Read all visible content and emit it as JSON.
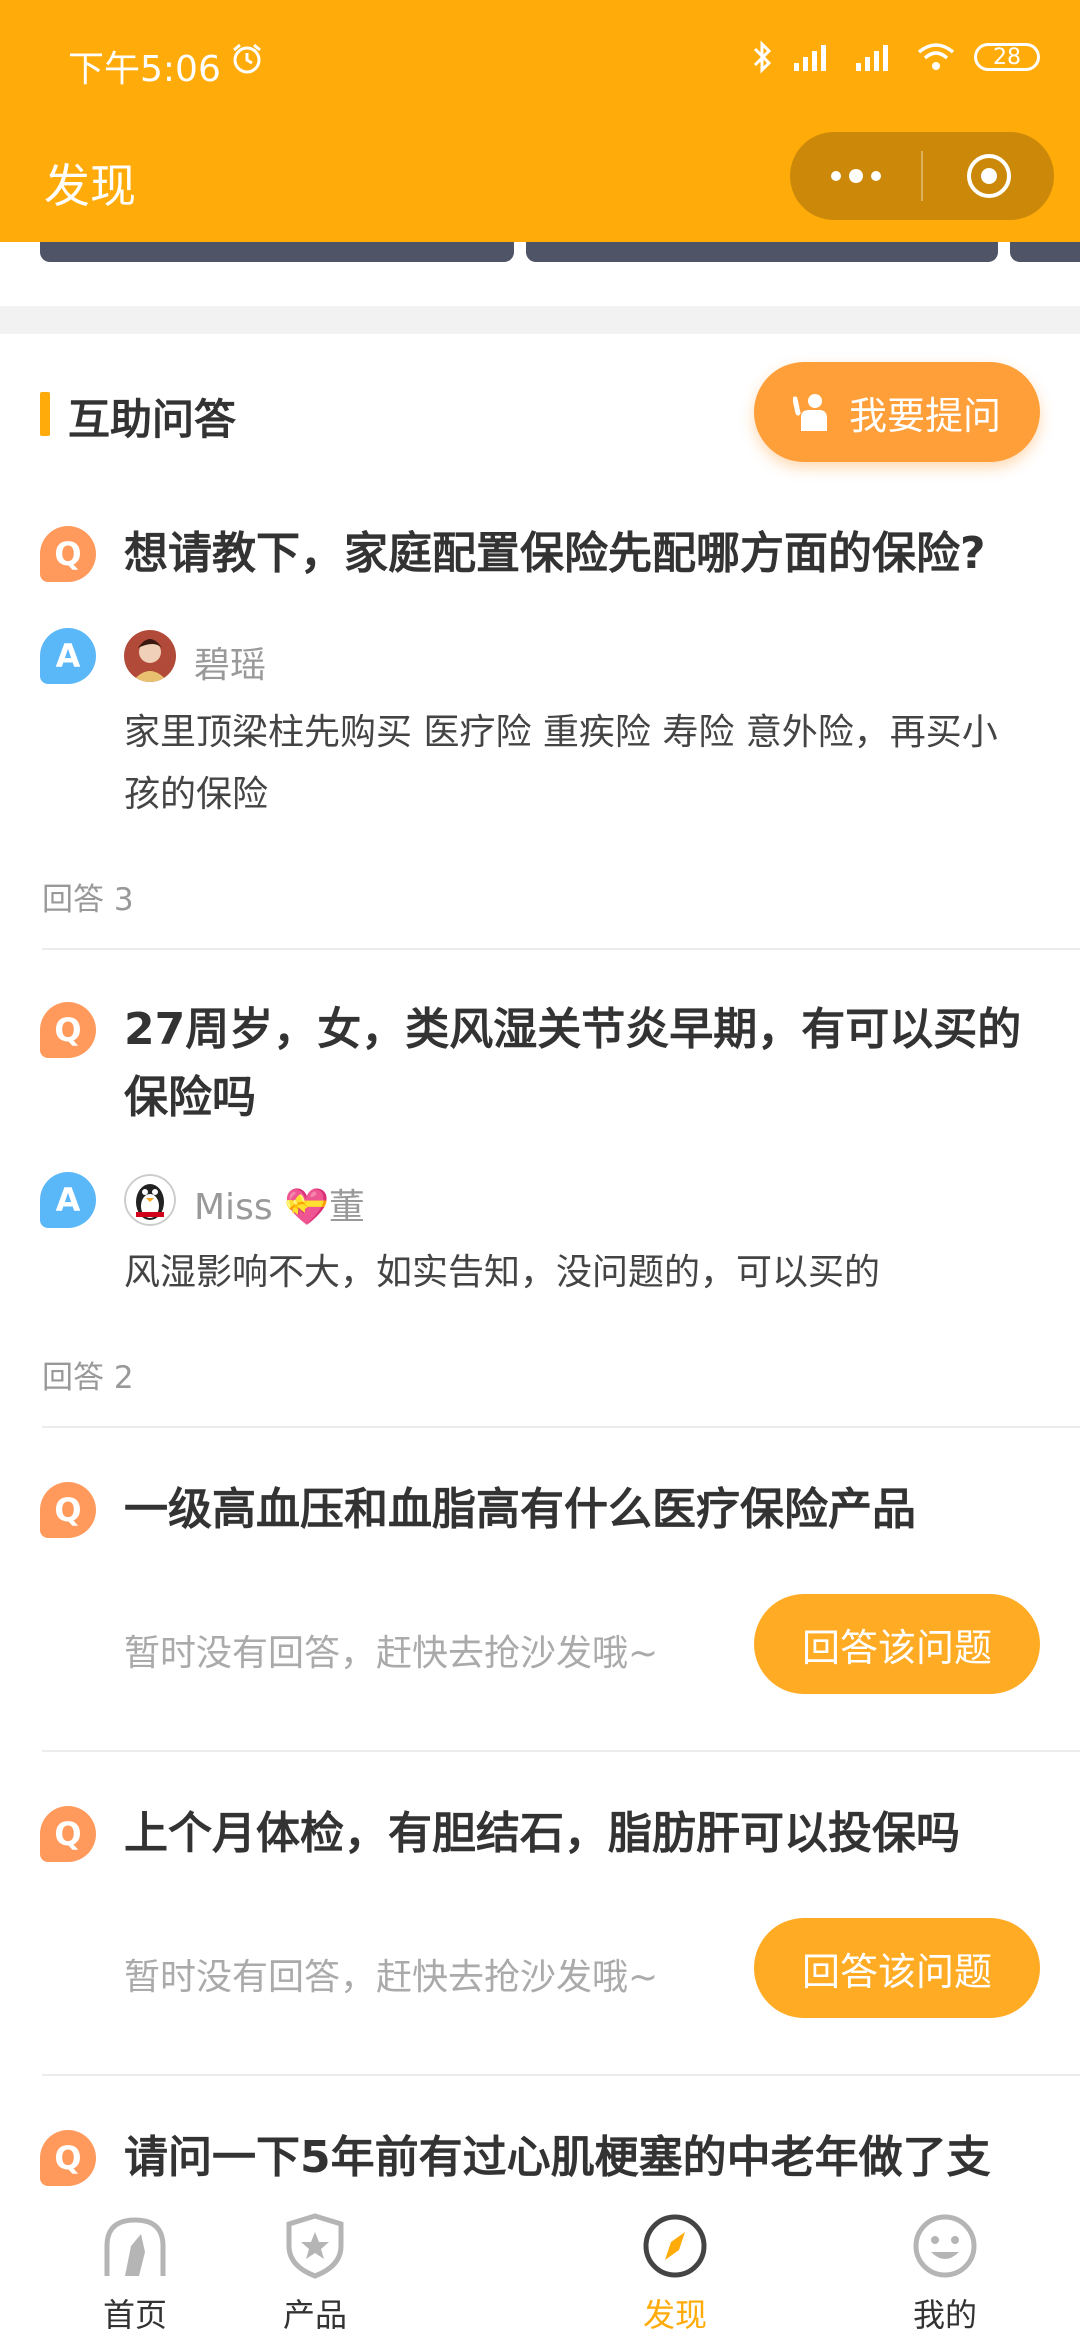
{
  "status_bar": {
    "time": "下午5:06",
    "battery": "28"
  },
  "nav": {
    "title": "发现"
  },
  "section": {
    "title": "互助问答",
    "ask_button": "我要提问"
  },
  "questions": [
    {
      "question": "想请教下，家庭配置保险先配哪方面的保险?",
      "answerer": "碧瑶",
      "answer": "家里顶梁柱先购买 医疗险 重疾险 寿险 意外险，再买小孩的保险",
      "count": "回答 3"
    },
    {
      "question": "27周岁，女，类风湿关节炎早期，有可以买的保险吗",
      "answerer": "Miss 💝董",
      "answer": "风湿影响不大，如实告知，没问题的，可以买的",
      "count": "回答 2"
    },
    {
      "question": "一级高血压和血脂高有什么医疗保险产品",
      "no_answer": "暂时没有回答，赶快去抢沙发哦~",
      "reply_button": "回答该问题"
    },
    {
      "question": "上个月体检，有胆结石，脂肪肝可以投保吗",
      "no_answer": "暂时没有回答，赶快去抢沙发哦~",
      "reply_button": "回答该问题"
    },
    {
      "question": "请问一下5年前有过心肌梗塞的中老年做了支"
    }
  ],
  "badges": {
    "q": "Q",
    "a": "A"
  },
  "tabbar": [
    {
      "label": "首页",
      "icon": "home-icon"
    },
    {
      "label": "产品",
      "icon": "shield-star-icon"
    },
    {
      "label": "发现",
      "icon": "compass-icon",
      "active": true
    },
    {
      "label": "我的",
      "icon": "smiley-icon"
    }
  ],
  "colors": {
    "brand": "#FFAB0A",
    "question_badge": "#FF9A5C",
    "answer_badge": "#5AB8F8",
    "button": "#FFAB24"
  }
}
